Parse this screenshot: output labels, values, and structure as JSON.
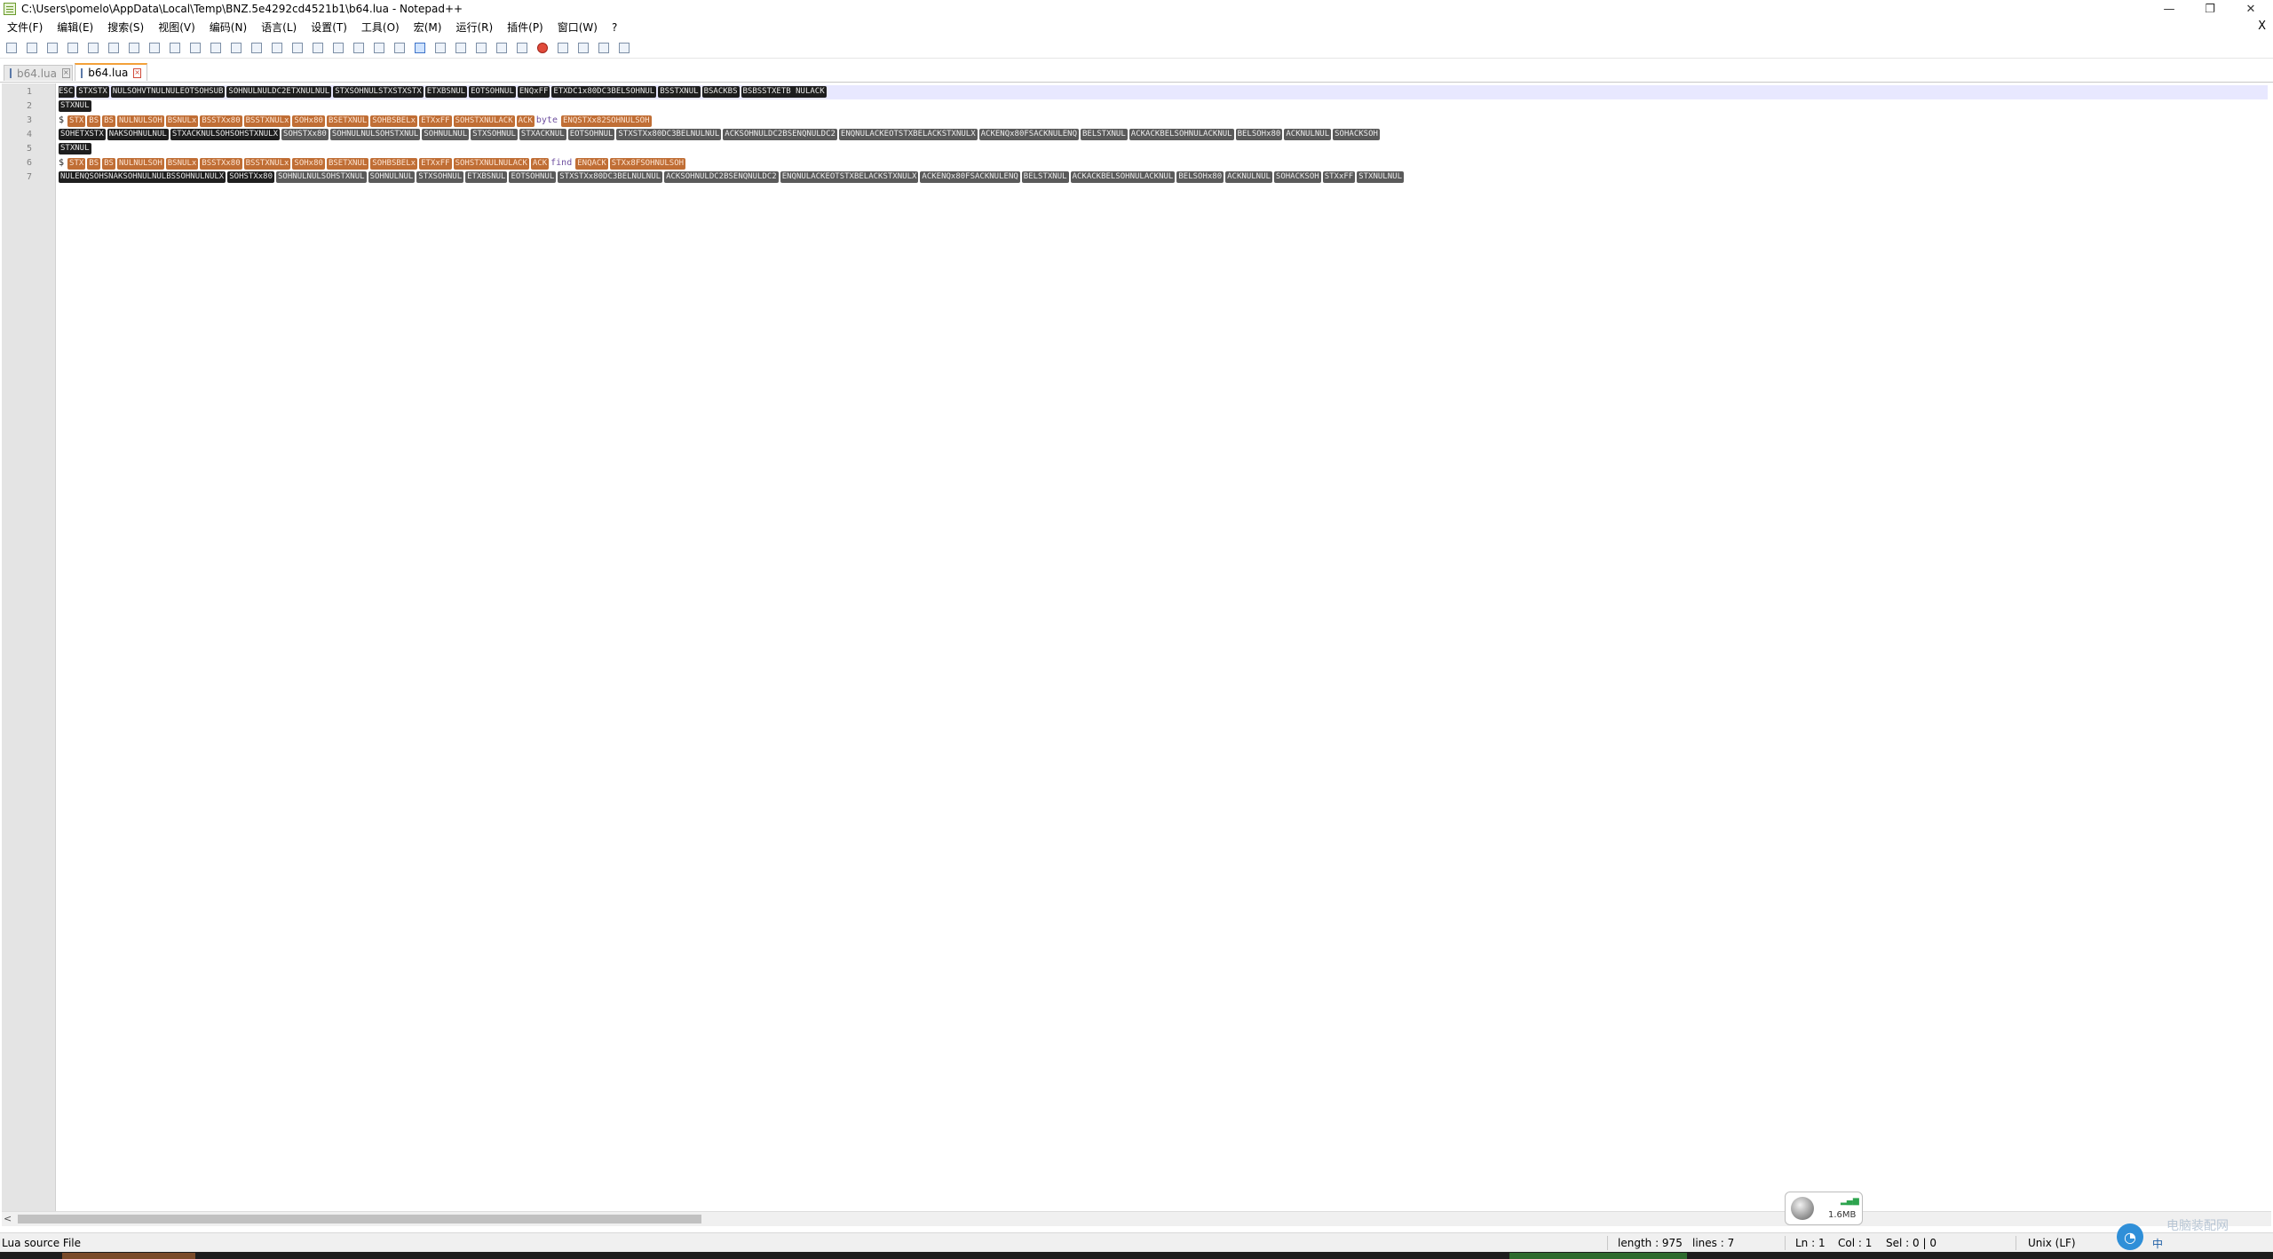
{
  "window": {
    "title": "C:\\Users\\pomelo\\AppData\\Local\\Temp\\BNZ.5e4292cd4521b1\\b64.lua - Notepad++",
    "minimize": "—",
    "restore": "❐",
    "close": "✕"
  },
  "menu": [
    "文件(F)",
    "编辑(E)",
    "搜索(S)",
    "视图(V)",
    "编码(N)",
    "语言(L)",
    "设置(T)",
    "工具(O)",
    "宏(M)",
    "运行(R)",
    "插件(P)",
    "窗口(W)",
    "?"
  ],
  "menu_close": "X",
  "tabs": [
    {
      "label": "b64.lua",
      "active": false
    },
    {
      "label": "b64.lua",
      "active": true
    }
  ],
  "editor": {
    "line_numbers": [
      "1",
      "2",
      "3",
      "4",
      "5",
      "6",
      "7"
    ],
    "lines": [
      {
        "segments": [
          [
            "dark",
            "ESC"
          ],
          [
            "dark",
            "STXSTX"
          ],
          [
            "dark",
            "NULSOHVTNULNULEOTSOHSUB"
          ],
          [
            "dark",
            "SOHNULNULDC2ETXNULNUL"
          ],
          [
            "dark",
            "STXSOHNULSTXSTXSTX"
          ],
          [
            "dark",
            "ETXBSNUL"
          ],
          [
            "dark",
            "EOTSOHNUL"
          ],
          [
            "dark",
            "ENQxFF"
          ],
          [
            "dark",
            "ETXDC1x80DC3BELSOHNUL"
          ],
          [
            "dark",
            "BSSTXNUL"
          ],
          [
            "dark",
            "BSACKBS"
          ],
          [
            "dark",
            "BSBSSTXETB NULACK"
          ]
        ]
      },
      {
        "segments": [
          [
            "dark",
            "STXNUL"
          ]
        ]
      },
      {
        "segments": [
          [
            "plain",
            "$"
          ],
          [
            "orange",
            "STX"
          ],
          [
            "orange",
            "BS"
          ],
          [
            "orange",
            "BS"
          ],
          [
            "orange",
            "NULNULSOH"
          ],
          [
            "orange",
            "BSNULx"
          ],
          [
            "orange",
            "BSSTXx80"
          ],
          [
            "orange",
            "BSSTXNULx"
          ],
          [
            "orange",
            "SOHx80"
          ],
          [
            "orange",
            "BSETXNUL"
          ],
          [
            "orange",
            "SOHBSBELx"
          ],
          [
            "orange",
            "ETXxFF"
          ],
          [
            "orange",
            "SOHSTXNULACK"
          ],
          [
            "orange",
            "ACK"
          ],
          [
            "plainp",
            "byte"
          ],
          [
            "orange",
            "ENQSTXx82SOHNULSOH"
          ]
        ]
      },
      {
        "segments": [
          [
            "dark",
            "SOHETXSTX"
          ],
          [
            "dark",
            "NAKSOHNULNUL"
          ],
          [
            "dark",
            "STXACKNULSOHSOHSTXNULX"
          ],
          [
            "gray",
            "SOHSTXx80"
          ],
          [
            "gray",
            "SOHNULNULSOHSTXNUL"
          ],
          [
            "gray",
            "SOHNULNUL"
          ],
          [
            "gray",
            "STXSOHNUL"
          ],
          [
            "gray",
            "STXACKNUL"
          ],
          [
            "gray",
            "EOTSOHNUL"
          ],
          [
            "gray",
            "STXSTXx80DC3BELNULNUL"
          ],
          [
            "gray",
            "ACKSOHNULDC2BSENQNULDC2"
          ],
          [
            "gray",
            "ENQNULACKEOTSTXBELACKSTXNULX"
          ],
          [
            "gray",
            "ACKENQx80FSACKNULENQ"
          ],
          [
            "gray",
            "BELSTXNUL"
          ],
          [
            "gray",
            "ACKACKBELSOHNULACKNUL"
          ],
          [
            "gray",
            "BELSOHx80"
          ],
          [
            "gray",
            "ACKNULNUL"
          ],
          [
            "gray",
            "SOHACKSOH"
          ]
        ]
      },
      {
        "segments": [
          [
            "dark",
            "STXNUL"
          ]
        ]
      },
      {
        "segments": [
          [
            "plain",
            "$"
          ],
          [
            "orange",
            "STX"
          ],
          [
            "orange",
            "BS"
          ],
          [
            "orange",
            "BS"
          ],
          [
            "orange",
            "NULNULSOH"
          ],
          [
            "orange",
            "BSNULx"
          ],
          [
            "orange",
            "BSSTXx80"
          ],
          [
            "orange",
            "BSSTXNULx"
          ],
          [
            "orange",
            "SOHx80"
          ],
          [
            "orange",
            "BSETXNUL"
          ],
          [
            "orange",
            "SOHBSBELx"
          ],
          [
            "orange",
            "ETXxFF"
          ],
          [
            "orange",
            "SOHSTXNULNULACK"
          ],
          [
            "orange",
            "ACK"
          ],
          [
            "plainp",
            "find"
          ],
          [
            "orange",
            "ENQACK"
          ],
          [
            "orange",
            "STXx8FSOHNULSOH"
          ]
        ]
      },
      {
        "segments": [
          [
            "dark",
            "NULENQSOHSNAKSOHNULNULBSSOHNULNULX"
          ],
          [
            "dark",
            "SOHSTXx80"
          ],
          [
            "gray",
            "SOHNULNULSOHSTXNUL"
          ],
          [
            "gray",
            "SOHNULNUL"
          ],
          [
            "gray",
            "STXSOHNUL"
          ],
          [
            "gray",
            "ETXBSNUL"
          ],
          [
            "gray",
            "EOTSOHNUL"
          ],
          [
            "gray",
            "STXSTXx80DC3BELNULNUL"
          ],
          [
            "gray",
            "ACKSOHNULDC2BSENQNULDC2"
          ],
          [
            "gray",
            "ENQNULACKEOTSTXBELACKSTXNULX"
          ],
          [
            "gray",
            "ACKENQx80FSACKNULENQ"
          ],
          [
            "gray",
            "BELSTXNUL"
          ],
          [
            "gray",
            "ACKACKBELSOHNULACKNUL"
          ],
          [
            "gray",
            "BELSOHx80"
          ],
          [
            "gray",
            "ACKNULNUL"
          ],
          [
            "gray",
            "SOHACKSOH"
          ],
          [
            "gray",
            "STXxFF"
          ],
          [
            "gray",
            "STXNULNUL"
          ]
        ]
      }
    ]
  },
  "statusbar": {
    "file_type": "Lua source File",
    "length": "length : 975",
    "lines": "lines : 7",
    "ln": "Ln : 1",
    "col": "Col : 1",
    "sel": "Sel : 0 | 0",
    "eol": "Unix (LF)"
  },
  "net_widget": {
    "speed": "1.6MB"
  },
  "ime": {
    "lang": "中"
  },
  "watermark": "电脑装配网"
}
